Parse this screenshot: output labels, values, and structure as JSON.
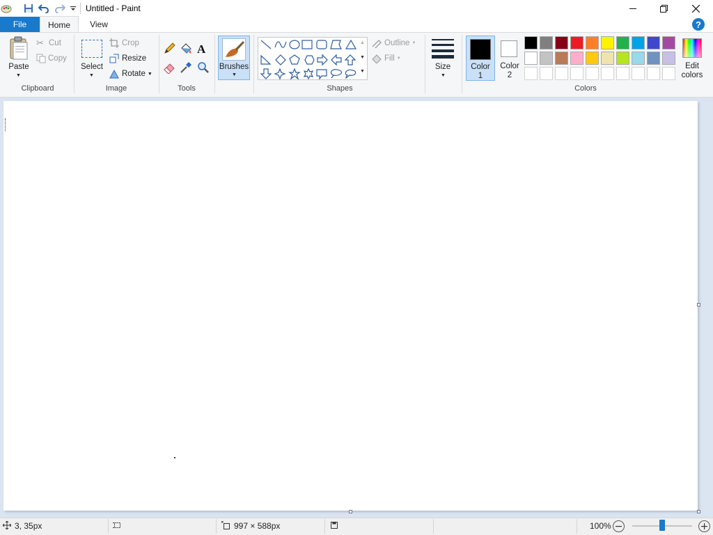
{
  "window": {
    "title": "Untitled - Paint",
    "minimize_icon": "minimize-icon",
    "maximize_icon": "restore-icon",
    "close_icon": "close-icon"
  },
  "quick_access": [
    "paint-app-icon",
    "save-icon",
    "undo-icon",
    "redo-icon",
    "customize-dropdown-icon"
  ],
  "tabs": [
    {
      "label": "File",
      "active": false
    },
    {
      "label": "Home",
      "active": true
    },
    {
      "label": "View",
      "active": false
    }
  ],
  "ribbon": {
    "clipboard": {
      "paste": "Paste",
      "cut": "Cut",
      "copy": "Copy",
      "group": "Clipboard"
    },
    "image": {
      "select": "Select",
      "crop": "Crop",
      "resize": "Resize",
      "rotate": "Rotate",
      "group": "Image"
    },
    "tools": {
      "group": "Tools",
      "items": [
        "pencil-icon",
        "fill-icon",
        "text-icon",
        "eraser-icon",
        "color-picker-icon",
        "magnifier-icon"
      ]
    },
    "brushes": {
      "label": "Brushes"
    },
    "shapes": {
      "outline": "Outline",
      "fill": "Fill",
      "group": "Shapes"
    },
    "size": {
      "label": "Size"
    },
    "colors": {
      "color1_line1": "Color",
      "color1_line2": "1",
      "color2_line1": "Color",
      "color2_line2": "2",
      "color1_value": "#000000",
      "color2_value": "#ffffff",
      "edit_line1": "Edit",
      "edit_line2": "colors",
      "group": "Colors",
      "palette_row1": [
        "#000000",
        "#7f7f7f",
        "#880015",
        "#ed1c24",
        "#ff7f27",
        "#fff200",
        "#22b14c",
        "#00a2e8",
        "#3f48cc",
        "#a349a4"
      ],
      "palette_row2": [
        "#ffffff",
        "#c3c3c3",
        "#b97a57",
        "#ffaec9",
        "#ffc90e",
        "#efe4b0",
        "#b5e61d",
        "#99d9ea",
        "#7092be",
        "#c8bfe7"
      ]
    }
  },
  "status": {
    "cursor_position": "3, 35px",
    "canvas_size": "997 × 588px",
    "zoom": "100%",
    "zoom_level": 0.5
  },
  "accent": "#1979ca"
}
